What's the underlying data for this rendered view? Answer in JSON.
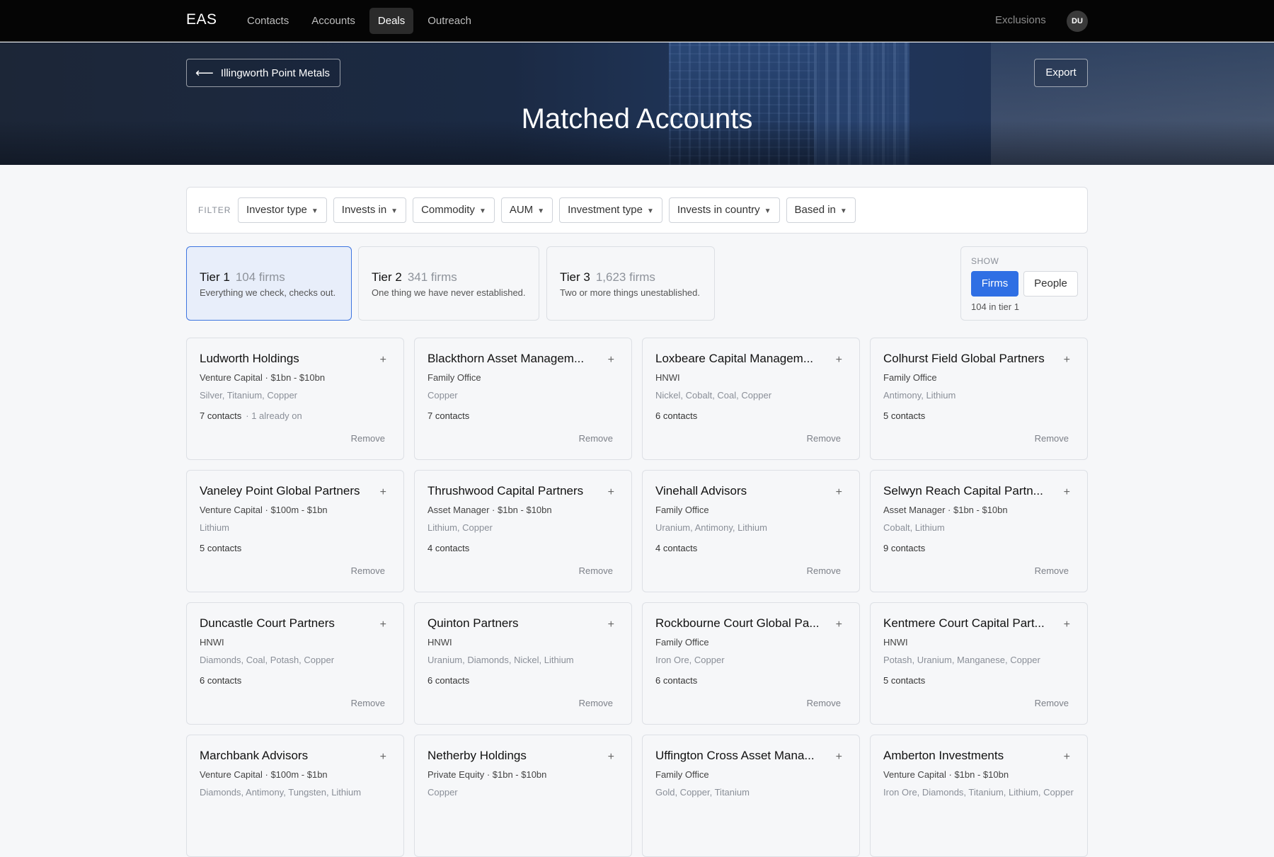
{
  "nav": {
    "brand": "EAS",
    "links": [
      "Contacts",
      "Accounts",
      "Deals",
      "Outreach"
    ],
    "active": "Deals",
    "exclusions": "Exclusions",
    "avatar": "DU"
  },
  "hero": {
    "back_label": "Illingworth Point Metals",
    "back_icon": "arrow-left-icon",
    "export_label": "Export",
    "title": "Matched Accounts"
  },
  "filter": {
    "label": "FILTER",
    "options": [
      "Investor type",
      "Invests in",
      "Commodity",
      "AUM",
      "Investment type",
      "Invests in country",
      "Based in"
    ],
    "caret": "▼"
  },
  "tiers": [
    {
      "name": "Tier 1",
      "count": "104 firms",
      "desc": "Everything we check, checks out.",
      "active": true
    },
    {
      "name": "Tier 2",
      "count": "341 firms",
      "desc": "One thing we have never established.",
      "active": false
    },
    {
      "name": "Tier 3",
      "count": "1,623 firms",
      "desc": "Two or more things unestablished.",
      "active": false
    }
  ],
  "show": {
    "label": "SHOW",
    "firms": "Firms",
    "people": "People",
    "selected": "Firms",
    "count": "104 in tier 1"
  },
  "cards": [
    {
      "name": "Ludworth Holdings",
      "type": "Venture Capital · $1bn - $10bn",
      "commodities": "Silver, Titanium, Copper",
      "contacts": "7 contacts",
      "already": "· 1 already on"
    },
    {
      "name": "Blackthorn Asset Managem...",
      "type": "Family Office",
      "commodities": "Copper",
      "contacts": "7 contacts",
      "already": ""
    },
    {
      "name": "Loxbeare Capital Managem...",
      "type": "HNWI",
      "commodities": "Nickel, Cobalt, Coal, Copper",
      "contacts": "6 contacts",
      "already": ""
    },
    {
      "name": "Colhurst Field Global Partners",
      "type": "Family Office",
      "commodities": "Antimony, Lithium",
      "contacts": "5 contacts",
      "already": ""
    },
    {
      "name": "Vaneley Point Global Partners",
      "type": "Venture Capital · $100m - $1bn",
      "commodities": "Lithium",
      "contacts": "5 contacts",
      "already": ""
    },
    {
      "name": "Thrushwood Capital Partners",
      "type": "Asset Manager · $1bn - $10bn",
      "commodities": "Lithium, Copper",
      "contacts": "4 contacts",
      "already": ""
    },
    {
      "name": "Vinehall Advisors",
      "type": "Family Office",
      "commodities": "Uranium, Antimony, Lithium",
      "contacts": "4 contacts",
      "already": ""
    },
    {
      "name": "Selwyn Reach Capital Partn...",
      "type": "Asset Manager · $1bn - $10bn",
      "commodities": "Cobalt, Lithium",
      "contacts": "9 contacts",
      "already": ""
    },
    {
      "name": "Duncastle Court Partners",
      "type": "HNWI",
      "commodities": "Diamonds, Coal, Potash, Copper",
      "contacts": "6 contacts",
      "already": ""
    },
    {
      "name": "Quinton Partners",
      "type": "HNWI",
      "commodities": "Uranium, Diamonds, Nickel, Lithium",
      "contacts": "6 contacts",
      "already": ""
    },
    {
      "name": "Rockbourne Court Global Pa...",
      "type": "Family Office",
      "commodities": "Iron Ore, Copper",
      "contacts": "6 contacts",
      "already": ""
    },
    {
      "name": "Kentmere Court Capital Part...",
      "type": "HNWI",
      "commodities": "Potash, Uranium, Manganese, Copper",
      "contacts": "5 contacts",
      "already": ""
    },
    {
      "name": "Marchbank Advisors",
      "type": "Venture Capital · $100m - $1bn",
      "commodities": "Diamonds, Antimony, Tungsten, Lithium",
      "contacts": "",
      "already": ""
    },
    {
      "name": "Netherby Holdings",
      "type": "Private Equity · $1bn - $10bn",
      "commodities": "Copper",
      "contacts": "",
      "already": ""
    },
    {
      "name": "Uffington Cross Asset Mana...",
      "type": "Family Office",
      "commodities": "Gold, Copper, Titanium",
      "contacts": "",
      "already": ""
    },
    {
      "name": "Amberton Investments",
      "type": "Venture Capital · $1bn - $10bn",
      "commodities": "Iron Ore, Diamonds, Titanium, Lithium, Copper",
      "contacts": "",
      "already": ""
    }
  ],
  "card_labels": {
    "plus": "+",
    "remove": "Remove"
  },
  "colors": {
    "accent": "#2f6fe4",
    "tier_active_bg": "#e8eefa",
    "nav_bg": "#050505"
  }
}
